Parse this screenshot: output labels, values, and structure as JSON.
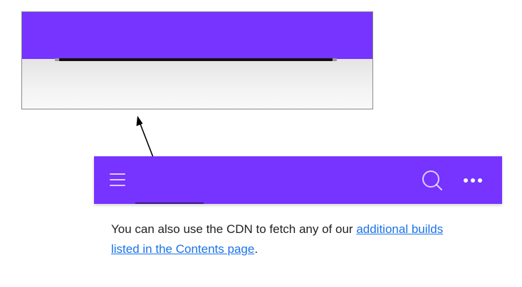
{
  "zoom_inset": {
    "purple_color": "#7733ff",
    "underline_color": "#111111"
  },
  "app_bar": {
    "background": "#7733ff",
    "menu_icon": "hamburger-menu-icon",
    "search_icon": "search-icon",
    "more_icon": "more-horizontal-icon"
  },
  "content": {
    "text_before_link": "You can also use the CDN to fetch any of our ",
    "link_line1": "additional builds",
    "link_line2": "listed in the Contents page",
    "text_after_link": "."
  }
}
